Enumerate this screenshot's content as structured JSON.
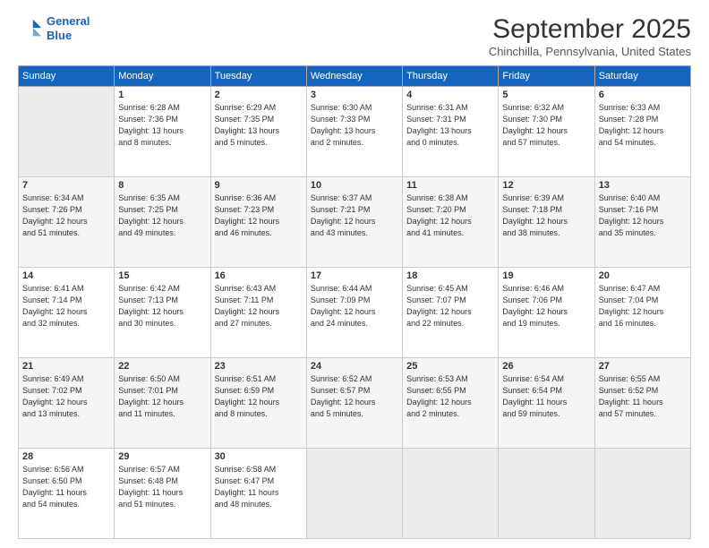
{
  "header": {
    "logo_line1": "General",
    "logo_line2": "Blue",
    "month_title": "September 2025",
    "subtitle": "Chinchilla, Pennsylvania, United States"
  },
  "days_of_week": [
    "Sunday",
    "Monday",
    "Tuesday",
    "Wednesday",
    "Thursday",
    "Friday",
    "Saturday"
  ],
  "weeks": [
    [
      {
        "date": "",
        "info": ""
      },
      {
        "date": "1",
        "info": "Sunrise: 6:28 AM\nSunset: 7:36 PM\nDaylight: 13 hours\nand 8 minutes."
      },
      {
        "date": "2",
        "info": "Sunrise: 6:29 AM\nSunset: 7:35 PM\nDaylight: 13 hours\nand 5 minutes."
      },
      {
        "date": "3",
        "info": "Sunrise: 6:30 AM\nSunset: 7:33 PM\nDaylight: 13 hours\nand 2 minutes."
      },
      {
        "date": "4",
        "info": "Sunrise: 6:31 AM\nSunset: 7:31 PM\nDaylight: 13 hours\nand 0 minutes."
      },
      {
        "date": "5",
        "info": "Sunrise: 6:32 AM\nSunset: 7:30 PM\nDaylight: 12 hours\nand 57 minutes."
      },
      {
        "date": "6",
        "info": "Sunrise: 6:33 AM\nSunset: 7:28 PM\nDaylight: 12 hours\nand 54 minutes."
      }
    ],
    [
      {
        "date": "7",
        "info": "Sunrise: 6:34 AM\nSunset: 7:26 PM\nDaylight: 12 hours\nand 51 minutes."
      },
      {
        "date": "8",
        "info": "Sunrise: 6:35 AM\nSunset: 7:25 PM\nDaylight: 12 hours\nand 49 minutes."
      },
      {
        "date": "9",
        "info": "Sunrise: 6:36 AM\nSunset: 7:23 PM\nDaylight: 12 hours\nand 46 minutes."
      },
      {
        "date": "10",
        "info": "Sunrise: 6:37 AM\nSunset: 7:21 PM\nDaylight: 12 hours\nand 43 minutes."
      },
      {
        "date": "11",
        "info": "Sunrise: 6:38 AM\nSunset: 7:20 PM\nDaylight: 12 hours\nand 41 minutes."
      },
      {
        "date": "12",
        "info": "Sunrise: 6:39 AM\nSunset: 7:18 PM\nDaylight: 12 hours\nand 38 minutes."
      },
      {
        "date": "13",
        "info": "Sunrise: 6:40 AM\nSunset: 7:16 PM\nDaylight: 12 hours\nand 35 minutes."
      }
    ],
    [
      {
        "date": "14",
        "info": "Sunrise: 6:41 AM\nSunset: 7:14 PM\nDaylight: 12 hours\nand 32 minutes."
      },
      {
        "date": "15",
        "info": "Sunrise: 6:42 AM\nSunset: 7:13 PM\nDaylight: 12 hours\nand 30 minutes."
      },
      {
        "date": "16",
        "info": "Sunrise: 6:43 AM\nSunset: 7:11 PM\nDaylight: 12 hours\nand 27 minutes."
      },
      {
        "date": "17",
        "info": "Sunrise: 6:44 AM\nSunset: 7:09 PM\nDaylight: 12 hours\nand 24 minutes."
      },
      {
        "date": "18",
        "info": "Sunrise: 6:45 AM\nSunset: 7:07 PM\nDaylight: 12 hours\nand 22 minutes."
      },
      {
        "date": "19",
        "info": "Sunrise: 6:46 AM\nSunset: 7:06 PM\nDaylight: 12 hours\nand 19 minutes."
      },
      {
        "date": "20",
        "info": "Sunrise: 6:47 AM\nSunset: 7:04 PM\nDaylight: 12 hours\nand 16 minutes."
      }
    ],
    [
      {
        "date": "21",
        "info": "Sunrise: 6:49 AM\nSunset: 7:02 PM\nDaylight: 12 hours\nand 13 minutes."
      },
      {
        "date": "22",
        "info": "Sunrise: 6:50 AM\nSunset: 7:01 PM\nDaylight: 12 hours\nand 11 minutes."
      },
      {
        "date": "23",
        "info": "Sunrise: 6:51 AM\nSunset: 6:59 PM\nDaylight: 12 hours\nand 8 minutes."
      },
      {
        "date": "24",
        "info": "Sunrise: 6:52 AM\nSunset: 6:57 PM\nDaylight: 12 hours\nand 5 minutes."
      },
      {
        "date": "25",
        "info": "Sunrise: 6:53 AM\nSunset: 6:55 PM\nDaylight: 12 hours\nand 2 minutes."
      },
      {
        "date": "26",
        "info": "Sunrise: 6:54 AM\nSunset: 6:54 PM\nDaylight: 11 hours\nand 59 minutes."
      },
      {
        "date": "27",
        "info": "Sunrise: 6:55 AM\nSunset: 6:52 PM\nDaylight: 11 hours\nand 57 minutes."
      }
    ],
    [
      {
        "date": "28",
        "info": "Sunrise: 6:56 AM\nSunset: 6:50 PM\nDaylight: 11 hours\nand 54 minutes."
      },
      {
        "date": "29",
        "info": "Sunrise: 6:57 AM\nSunset: 6:48 PM\nDaylight: 11 hours\nand 51 minutes."
      },
      {
        "date": "30",
        "info": "Sunrise: 6:58 AM\nSunset: 6:47 PM\nDaylight: 11 hours\nand 48 minutes."
      },
      {
        "date": "",
        "info": ""
      },
      {
        "date": "",
        "info": ""
      },
      {
        "date": "",
        "info": ""
      },
      {
        "date": "",
        "info": ""
      }
    ]
  ]
}
